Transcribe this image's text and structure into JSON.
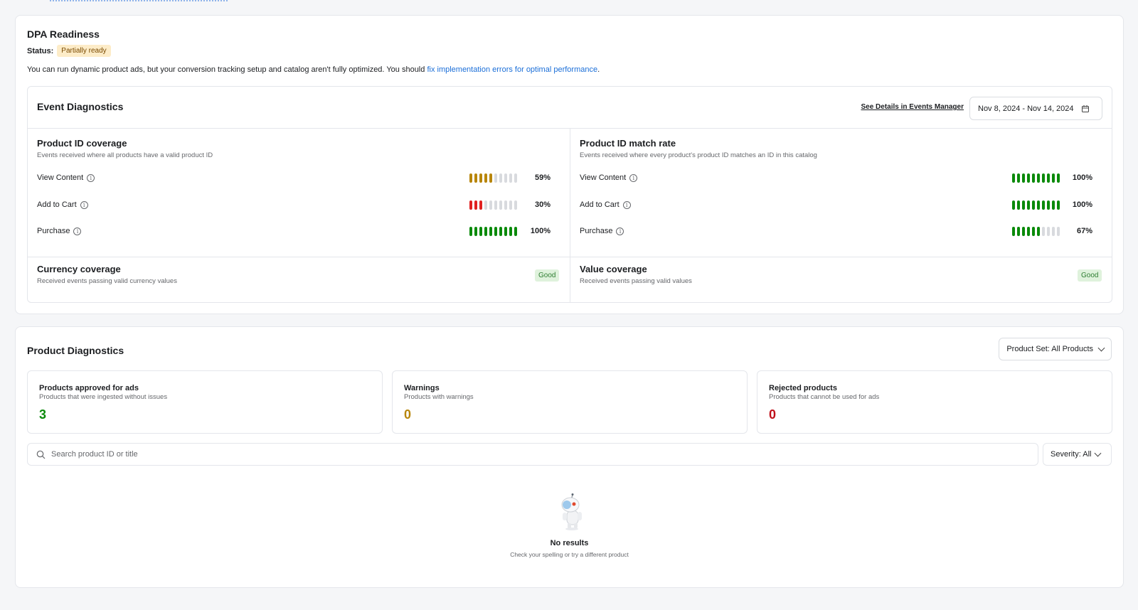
{
  "dpa": {
    "title": "DPA Readiness",
    "status_label": "Status:",
    "status_value": "Partially ready",
    "description_prefix": "You can run dynamic product ads, but your conversion tracking setup and catalog aren't fully optimized. You should ",
    "description_link": "fix implementation errors for optimal performance",
    "description_suffix": "."
  },
  "event_diagnostics": {
    "title": "Event Diagnostics",
    "details_link": "See Details in Events Manager",
    "date_range": "Nov 8, 2024 - Nov 14, 2024",
    "coverage": {
      "title": "Product ID coverage",
      "description": "Events received where all products have a valid product ID",
      "rows": [
        {
          "label": "View Content",
          "percent_text": "59%",
          "filled_segments": 5,
          "total_segments": 10,
          "color": "#b8860b"
        },
        {
          "label": "Add to Cart",
          "percent_text": "30%",
          "filled_segments": 3,
          "total_segments": 10,
          "color": "#e02020"
        },
        {
          "label": "Purchase",
          "percent_text": "100%",
          "filled_segments": 10,
          "total_segments": 10,
          "color": "#0a8a0a"
        }
      ]
    },
    "match_rate": {
      "title": "Product ID match rate",
      "description": "Events received where every product's product ID matches an ID in this catalog",
      "rows": [
        {
          "label": "View Content",
          "percent_text": "100%",
          "filled_segments": 10,
          "total_segments": 10,
          "color": "#0a8a0a"
        },
        {
          "label": "Add to Cart",
          "percent_text": "100%",
          "filled_segments": 10,
          "total_segments": 10,
          "color": "#0a8a0a"
        },
        {
          "label": "Purchase",
          "percent_text": "67%",
          "filled_segments": 6,
          "total_segments": 10,
          "color": "#0a8a0a"
        }
      ]
    },
    "currency": {
      "title": "Currency coverage",
      "description": "Received events passing valid currency values",
      "badge": "Good"
    },
    "value": {
      "title": "Value coverage",
      "description": "Received events passing valid values",
      "badge": "Good"
    }
  },
  "product_diagnostics": {
    "title": "Product Diagnostics",
    "product_set": "Product Set: All Products",
    "stats": [
      {
        "title": "Products approved for ads",
        "description": "Products that were ingested without issues",
        "value": "3",
        "color": "#0a8a0a"
      },
      {
        "title": "Warnings",
        "description": "Products with warnings",
        "value": "0",
        "color": "#b8860b"
      },
      {
        "title": "Rejected products",
        "description": "Products that cannot be used for ads",
        "value": "0",
        "color": "#c0101a"
      }
    ],
    "search_placeholder": "Search product ID or title",
    "severity": "Severity: All",
    "empty_title": "No results",
    "empty_description": "Check your spelling or try a different product"
  },
  "icons": {
    "info": "info-icon",
    "calendar": "calendar-icon",
    "search": "search-icon",
    "chevron": "chevron-down-icon",
    "empty_state": "robot-mascot-illustration"
  }
}
